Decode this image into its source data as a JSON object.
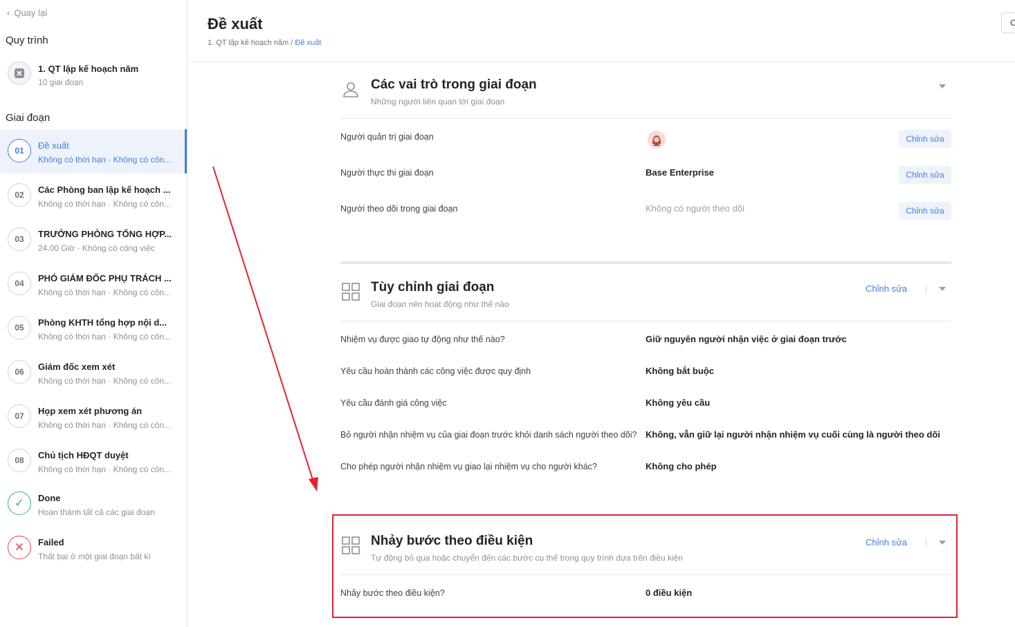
{
  "sidebar": {
    "back_label": "Quay lại",
    "process_section": "Quy trình",
    "process": {
      "title": "1. QT lập kế hoạch năm",
      "subtitle": "10 giai đoạn"
    },
    "stage_section": "Giai đoạn",
    "stages": [
      {
        "num": "01",
        "title": "Đề xuất",
        "subtitle": "Không có thời hạn · Không có côn...",
        "active": true
      },
      {
        "num": "02",
        "title": "Các Phòng ban lập kế hoạch ...",
        "subtitle": "Không có thời hạn · Không có côn..."
      },
      {
        "num": "03",
        "title": "TRƯỞNG PHÒNG TỔNG HỢP...",
        "subtitle": "24.00 Giờ · Không có công việc"
      },
      {
        "num": "04",
        "title": "PHÓ GIÁM ĐỐC PHỤ TRÁCH ...",
        "subtitle": "Không có thời hạn · Không có côn..."
      },
      {
        "num": "05",
        "title": "Phòng KHTH tổng hợp nội d...",
        "subtitle": "Không có thời hạn · Không có côn..."
      },
      {
        "num": "06",
        "title": "Giám đốc xem xét",
        "subtitle": "Không có thời hạn · Không có côn..."
      },
      {
        "num": "07",
        "title": "Họp xem xét phương án",
        "subtitle": "Không có thời hạn · Không có côn..."
      },
      {
        "num": "08",
        "title": "Chủ tịch HĐQT duyệt",
        "subtitle": "Không có thời hạn · Không có côn..."
      },
      {
        "num": "✓",
        "title": "Done",
        "subtitle": "Hoàn thành tất cả các giai đoạn",
        "kind": "done"
      },
      {
        "num": "✕",
        "title": "Failed",
        "subtitle": "Thất bại ở một giai đoạn bất kì",
        "kind": "failed"
      }
    ]
  },
  "header": {
    "title": "Đề xuất",
    "breadcrumb_parent": "1. QT lập kế hoạch năm",
    "breadcrumb_sep": " / ",
    "breadcrumb_current": "Đề xuất",
    "corner_button": "C"
  },
  "roles": {
    "title": "Các vai trò trong giai đoạn",
    "subtitle": "Những người liên quan tới giai đoạn",
    "edit_label": "Chỉnh sửa",
    "rows": [
      {
        "label": "Người quản trị giai đoạn",
        "value": ""
      },
      {
        "label": "Người thực thi giai đoạn",
        "value": "Base Enterprise"
      },
      {
        "label": "Người theo dõi trong giai đoạn",
        "value": "Không có người theo dõi"
      }
    ]
  },
  "custom": {
    "title": "Tùy chỉnh giai đoạn",
    "subtitle": "Giai đoạn nên hoạt động như thế nào",
    "edit_label": "Chỉnh sửa",
    "rows": [
      {
        "label": "Nhiệm vụ được giao tự động như thế nào?",
        "value": "Giữ nguyên người nhận việc ở giai đoạn trước"
      },
      {
        "label": "Yêu cầu hoàn thành các công việc được quy định",
        "value": "Không bắt buộc"
      },
      {
        "label": "Yêu cầu đánh giá công việc",
        "value": "Không yêu cầu"
      },
      {
        "label": "Bỏ người nhận nhiệm vụ của giai đoạn trước khỏi danh sách người theo dõi?",
        "value": "Không, vẫn giữ lại người nhận nhiệm vụ cuối cùng là người theo dõi"
      },
      {
        "label": "Cho phép người nhận nhiệm vụ giao lại nhiệm vụ cho người khác?",
        "value": "Không cho phép"
      }
    ]
  },
  "jump": {
    "title": "Nhảy bước theo điều kiện",
    "subtitle": "Tự động bỏ qua hoặc chuyển đến các bước cụ thể trong quy trình dựa trên điều kiện",
    "edit_label": "Chỉnh sửa",
    "rows": [
      {
        "label": "Nhảy bước theo điều kiện?",
        "value": "0 điều kiện"
      }
    ]
  },
  "colors": {
    "accent": "#3d7ee0",
    "annotation": "#e8212e",
    "done": "#3cb371",
    "failed": "#e04848"
  }
}
